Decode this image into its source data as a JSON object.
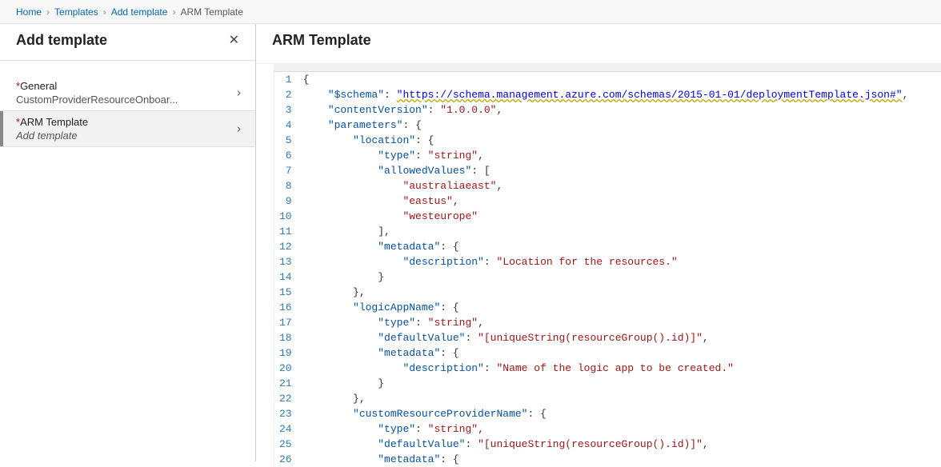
{
  "breadcrumb": [
    {
      "text": "Home",
      "link": true
    },
    {
      "text": "Templates",
      "link": true
    },
    {
      "text": "Add template",
      "link": true
    },
    {
      "text": "ARM Template",
      "link": false
    }
  ],
  "leftPane": {
    "title": "Add template",
    "closeLabel": "✕",
    "steps": [
      {
        "title": "General",
        "required": true,
        "sub": "CustomProviderResourceOnboar...",
        "subItalic": false,
        "chevron": "›",
        "active": false
      },
      {
        "title": "ARM Template",
        "required": true,
        "sub": "Add template",
        "subItalic": true,
        "chevron": "›",
        "active": true
      }
    ]
  },
  "rightPane": {
    "title": "ARM Template"
  },
  "editor": {
    "lines": [
      {
        "n": 1,
        "tokens": [
          {
            "t": "brace",
            "v": "{"
          }
        ]
      },
      {
        "n": 2,
        "indent": 1,
        "tokens": [
          {
            "t": "key",
            "v": "\"$schema\""
          },
          {
            "t": "colon",
            "v": ": "
          },
          {
            "t": "link",
            "v": "\"https://schema.management.azure.com/schemas/2015-01-01/deploymentTemplate.json#\""
          },
          {
            "t": "punc",
            "v": ","
          }
        ]
      },
      {
        "n": 3,
        "indent": 1,
        "tokens": [
          {
            "t": "key",
            "v": "\"contentVersion\""
          },
          {
            "t": "colon",
            "v": ": "
          },
          {
            "t": "str",
            "v": "\"1.0.0.0\""
          },
          {
            "t": "punc",
            "v": ","
          }
        ]
      },
      {
        "n": 4,
        "indent": 1,
        "tokens": [
          {
            "t": "key",
            "v": "\"parameters\""
          },
          {
            "t": "colon",
            "v": ": "
          },
          {
            "t": "brace",
            "v": "{"
          }
        ]
      },
      {
        "n": 5,
        "indent": 2,
        "tokens": [
          {
            "t": "key",
            "v": "\"location\""
          },
          {
            "t": "colon",
            "v": ": "
          },
          {
            "t": "brace",
            "v": "{"
          }
        ]
      },
      {
        "n": 6,
        "indent": 3,
        "tokens": [
          {
            "t": "key",
            "v": "\"type\""
          },
          {
            "t": "colon",
            "v": ": "
          },
          {
            "t": "str",
            "v": "\"string\""
          },
          {
            "t": "punc",
            "v": ","
          }
        ]
      },
      {
        "n": 7,
        "indent": 3,
        "tokens": [
          {
            "t": "key",
            "v": "\"allowedValues\""
          },
          {
            "t": "colon",
            "v": ": "
          },
          {
            "t": "brace",
            "v": "["
          }
        ]
      },
      {
        "n": 8,
        "indent": 4,
        "tokens": [
          {
            "t": "str",
            "v": "\"australiaeast\""
          },
          {
            "t": "punc",
            "v": ","
          }
        ]
      },
      {
        "n": 9,
        "indent": 4,
        "tokens": [
          {
            "t": "str",
            "v": "\"eastus\""
          },
          {
            "t": "punc",
            "v": ","
          }
        ]
      },
      {
        "n": 10,
        "indent": 4,
        "tokens": [
          {
            "t": "str",
            "v": "\"westeurope\""
          }
        ]
      },
      {
        "n": 11,
        "indent": 3,
        "tokens": [
          {
            "t": "brace",
            "v": "],"
          }
        ]
      },
      {
        "n": 12,
        "indent": 3,
        "tokens": [
          {
            "t": "key",
            "v": "\"metadata\""
          },
          {
            "t": "colon",
            "v": ": "
          },
          {
            "t": "brace",
            "v": "{"
          }
        ]
      },
      {
        "n": 13,
        "indent": 4,
        "tokens": [
          {
            "t": "key",
            "v": "\"description\""
          },
          {
            "t": "colon",
            "v": ": "
          },
          {
            "t": "str",
            "v": "\"Location for the resources.\""
          }
        ]
      },
      {
        "n": 14,
        "indent": 3,
        "tokens": [
          {
            "t": "brace",
            "v": "}"
          }
        ]
      },
      {
        "n": 15,
        "indent": 2,
        "tokens": [
          {
            "t": "brace",
            "v": "},"
          }
        ]
      },
      {
        "n": 16,
        "indent": 2,
        "tokens": [
          {
            "t": "key",
            "v": "\"logicAppName\""
          },
          {
            "t": "colon",
            "v": ": "
          },
          {
            "t": "brace",
            "v": "{"
          }
        ]
      },
      {
        "n": 17,
        "indent": 3,
        "tokens": [
          {
            "t": "key",
            "v": "\"type\""
          },
          {
            "t": "colon",
            "v": ": "
          },
          {
            "t": "str",
            "v": "\"string\""
          },
          {
            "t": "punc",
            "v": ","
          }
        ]
      },
      {
        "n": 18,
        "indent": 3,
        "tokens": [
          {
            "t": "key",
            "v": "\"defaultValue\""
          },
          {
            "t": "colon",
            "v": ": "
          },
          {
            "t": "str",
            "v": "\"[uniqueString(resourceGroup().id)]\""
          },
          {
            "t": "punc",
            "v": ","
          }
        ]
      },
      {
        "n": 19,
        "indent": 3,
        "tokens": [
          {
            "t": "key",
            "v": "\"metadata\""
          },
          {
            "t": "colon",
            "v": ": "
          },
          {
            "t": "brace",
            "v": "{"
          }
        ]
      },
      {
        "n": 20,
        "indent": 4,
        "tokens": [
          {
            "t": "key",
            "v": "\"description\""
          },
          {
            "t": "colon",
            "v": ": "
          },
          {
            "t": "str",
            "v": "\"Name of the logic app to be created.\""
          }
        ]
      },
      {
        "n": 21,
        "indent": 3,
        "tokens": [
          {
            "t": "brace",
            "v": "}"
          }
        ]
      },
      {
        "n": 22,
        "indent": 2,
        "tokens": [
          {
            "t": "brace",
            "v": "},"
          }
        ]
      },
      {
        "n": 23,
        "indent": 2,
        "tokens": [
          {
            "t": "key",
            "v": "\"customResourceProviderName\""
          },
          {
            "t": "colon",
            "v": ": "
          },
          {
            "t": "brace",
            "v": "{"
          }
        ]
      },
      {
        "n": 24,
        "indent": 3,
        "tokens": [
          {
            "t": "key",
            "v": "\"type\""
          },
          {
            "t": "colon",
            "v": ": "
          },
          {
            "t": "str",
            "v": "\"string\""
          },
          {
            "t": "punc",
            "v": ","
          }
        ]
      },
      {
        "n": 25,
        "indent": 3,
        "tokens": [
          {
            "t": "key",
            "v": "\"defaultValue\""
          },
          {
            "t": "colon",
            "v": ": "
          },
          {
            "t": "str",
            "v": "\"[uniqueString(resourceGroup().id)]\""
          },
          {
            "t": "punc",
            "v": ","
          }
        ]
      },
      {
        "n": 26,
        "indent": 3,
        "tokens": [
          {
            "t": "key",
            "v": "\"metadata\""
          },
          {
            "t": "colon",
            "v": ": "
          },
          {
            "t": "brace",
            "v": "{"
          }
        ]
      }
    ]
  }
}
